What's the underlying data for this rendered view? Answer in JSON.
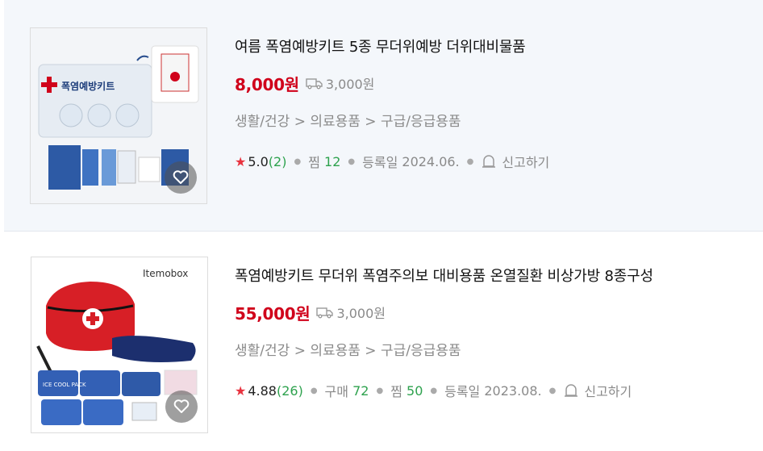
{
  "products": [
    {
      "title": "여름 폭염예방키트 5종 무더위예방 더위대비물품",
      "price": "8,000원",
      "shipping": "3,000원",
      "category": "생활/건강 > 의료용품 > 구급/응급용품",
      "rating": "5.0",
      "reviews": "(2)",
      "wish_label": "찜",
      "wish_count": "12",
      "reg_label": "등록일",
      "reg_date": "2024.06.",
      "report_label": "신고하기",
      "thumb_text": "폭염예방키트"
    },
    {
      "title": "폭염예방키트 무더위 폭염주의보 대비용품 온열질환 비상가방 8종구성",
      "price": "55,000원",
      "shipping": "3,000원",
      "category": "생활/건강 > 의료용품 > 구급/응급용품",
      "rating": "4.88",
      "reviews": "(26)",
      "buy_label": "구매",
      "buy_count": "72",
      "wish_label": "찜",
      "wish_count": "50",
      "reg_label": "등록일",
      "reg_date": "2023.08.",
      "report_label": "신고하기",
      "thumb_text": "Itemobox",
      "thumb_pack_text": "ICE COOL PACK"
    }
  ],
  "colors": {
    "price": "#d0021b",
    "star": "#e8333f",
    "count": "#2ea24e",
    "highlight_bg": "#f4f7fb"
  }
}
